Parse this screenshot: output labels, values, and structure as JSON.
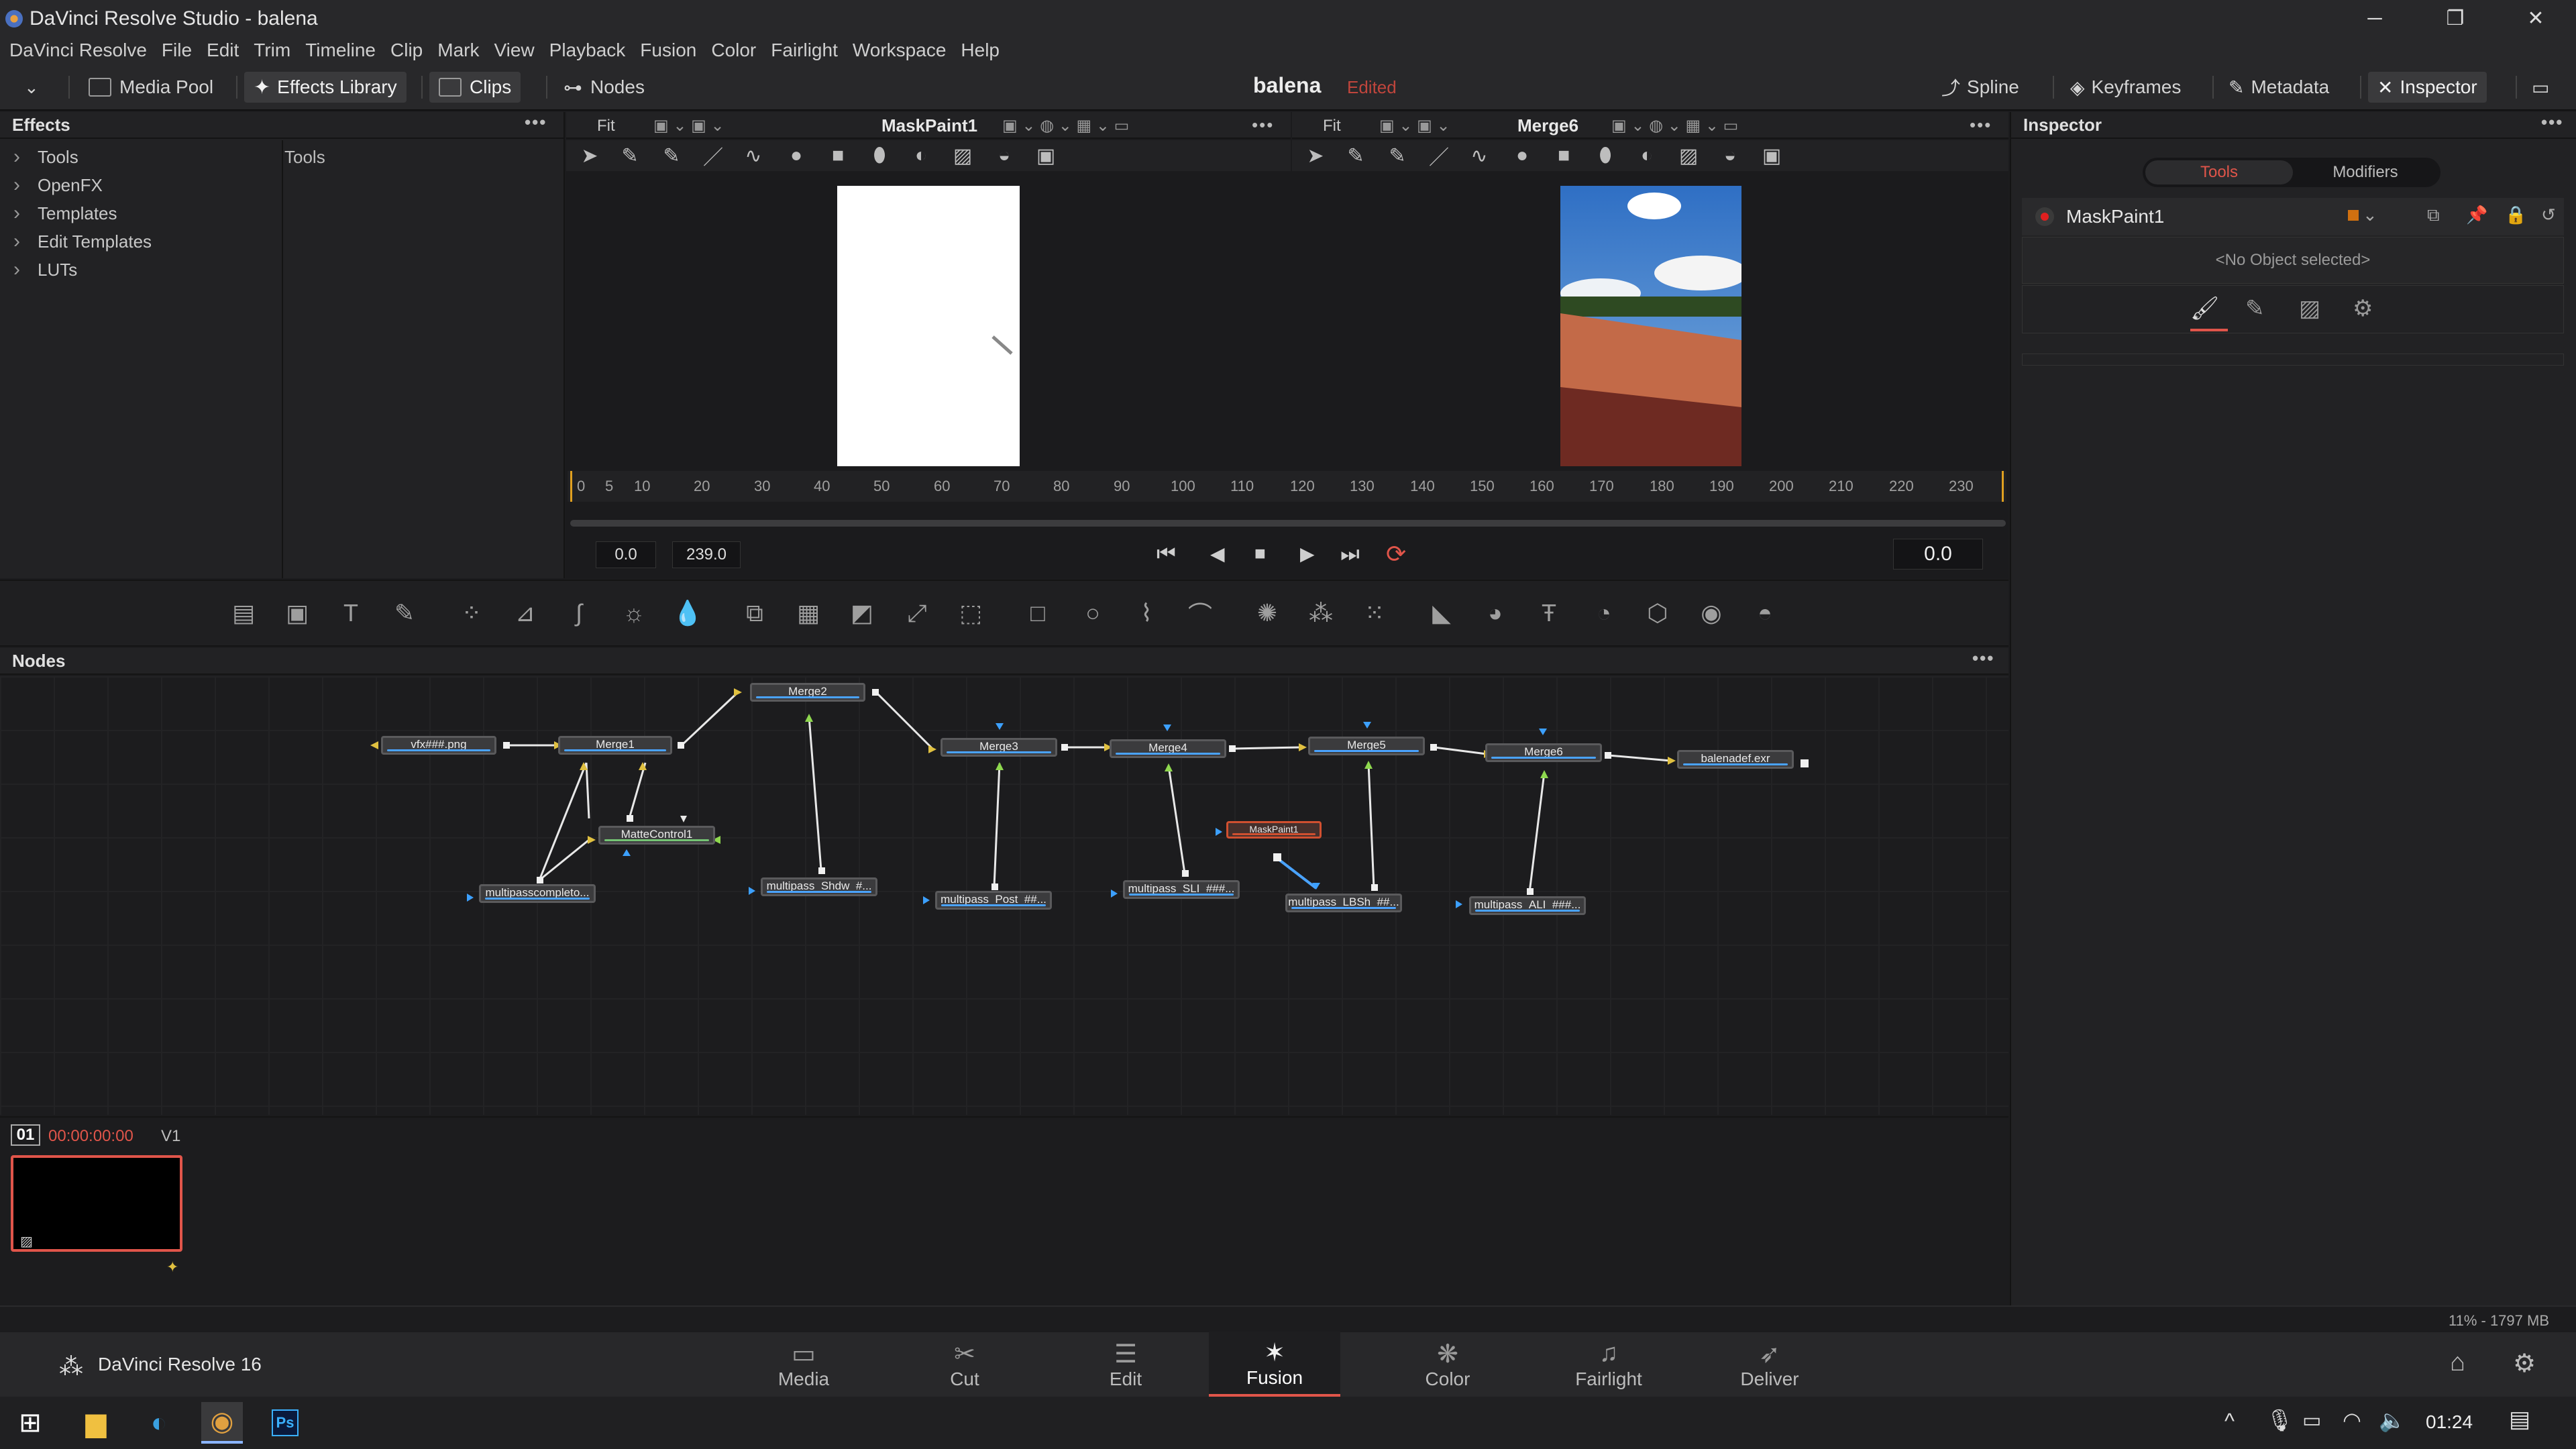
{
  "window": {
    "title": "DaVinci Resolve Studio - balena",
    "minimize": "─",
    "maximize": "❐",
    "close": "✕"
  },
  "menu": [
    "DaVinci Resolve",
    "File",
    "Edit",
    "Trim",
    "Timeline",
    "Clip",
    "Mark",
    "View",
    "Playback",
    "Fusion",
    "Color",
    "Fairlight",
    "Workspace",
    "Help"
  ],
  "toolbar": {
    "media_pool": "Media Pool",
    "effects_library": "Effects Library",
    "clips": "Clips",
    "nodes": "Nodes",
    "project": "balena",
    "edited": "Edited",
    "spline": "Spline",
    "keyframes": "Keyframes",
    "metadata": "Metadata",
    "inspector": "Inspector"
  },
  "effects": {
    "title": "Effects",
    "tree": [
      "Tools",
      "OpenFX",
      "Templates",
      "Edit Templates",
      "LUTs"
    ],
    "content_label": "Tools"
  },
  "viewer_left": {
    "fit": "Fit",
    "name": "MaskPaint1"
  },
  "viewer_right": {
    "fit": "Fit",
    "name": "Merge6"
  },
  "ruler": {
    "ticks": [
      "0",
      "5",
      "10",
      "20",
      "30",
      "40",
      "50",
      "60",
      "70",
      "80",
      "90",
      "100",
      "110",
      "120",
      "130",
      "140",
      "150",
      "160",
      "170",
      "180",
      "190",
      "200",
      "210",
      "220",
      "230"
    ]
  },
  "transport": {
    "start": "0.0",
    "end": "239.0",
    "current": "0.0"
  },
  "inspector": {
    "title": "Inspector",
    "tab_tools": "Tools",
    "tab_modifiers": "Modifiers",
    "node_name": "MaskPaint1",
    "empty_msg": "<No Object selected>"
  },
  "nodes_panel": {
    "title": "Nodes"
  },
  "nodes": [
    {
      "label": "vfx###.png"
    },
    {
      "label": "Merge1"
    },
    {
      "label": "Merge2"
    },
    {
      "label": "MatteControl1"
    },
    {
      "label": "multipasscompleto..."
    },
    {
      "label": "multipass_Shdw_#..."
    },
    {
      "label": "Merge3"
    },
    {
      "label": "multipass_Post_##..."
    },
    {
      "label": "Merge4"
    },
    {
      "label": "multipass_SLI_###..."
    },
    {
      "label": "MaskPaint1"
    },
    {
      "label": "Merge5"
    },
    {
      "label": "multipass_LBSh_##..."
    },
    {
      "label": "Merge6"
    },
    {
      "label": "multipass_ALI_###..."
    },
    {
      "label": "balenadef.exr"
    }
  ],
  "clips": {
    "index": "01",
    "timecode": "00:00:00:00",
    "track": "V1"
  },
  "status": {
    "memory": "11% - 1797 MB"
  },
  "footer": {
    "app_name": "DaVinci Resolve 16",
    "pages": [
      "Media",
      "Cut",
      "Edit",
      "Fusion",
      "Color",
      "Fairlight",
      "Deliver"
    ],
    "active_page": "Fusion"
  },
  "taskbar": {
    "time": "01:24"
  },
  "colors": {
    "accent": "#e0554a",
    "selection": "#4aa3ff",
    "bg": "#1c1c1e"
  }
}
